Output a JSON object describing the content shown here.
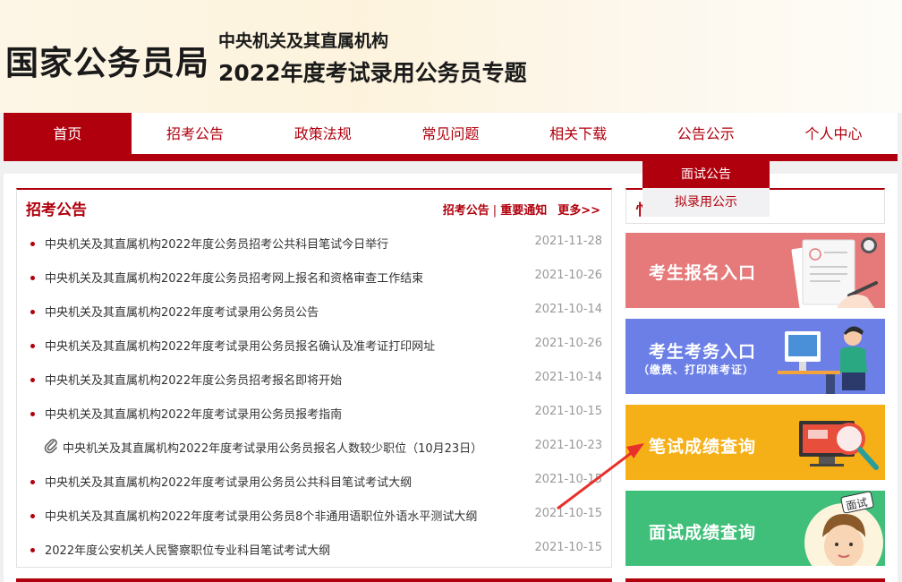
{
  "header": {
    "brand": "国家公务员局",
    "subtitle_line1": "中央机关及其直属机构",
    "subtitle_line2": "2022年度考试录用公务员专题"
  },
  "nav": {
    "items": [
      {
        "label": "首页",
        "active": true
      },
      {
        "label": "招考公告"
      },
      {
        "label": "政策法规"
      },
      {
        "label": "常见问题"
      },
      {
        "label": "相关下载"
      },
      {
        "label": "公告公示"
      },
      {
        "label": "个人中心"
      }
    ],
    "dropdown": [
      {
        "label": "面试公告",
        "active": true
      },
      {
        "label": "拟录用公示"
      }
    ]
  },
  "announcements": {
    "title": "招考公告",
    "link1": "招考公告",
    "sep": "|",
    "link2": "重要通知",
    "more": "更多>>",
    "items": [
      {
        "title": "中央机关及其直属机构2022年度公务员招考公共科目笔试今日举行",
        "date": "2021-11-28"
      },
      {
        "title": "中央机关及其直属机构2022年度公务员招考网上报名和资格审查工作结束",
        "date": "2021-10-26"
      },
      {
        "title": "中央机关及其直属机构2022年度考试录用公务员公告",
        "date": "2021-10-14"
      },
      {
        "title": "中央机关及其直属机构2022年度考试录用公务员报名确认及准考证打印网址",
        "date": "2021-10-26"
      },
      {
        "title": "中央机关及其直属机构2022年度公务员招考报名即将开始",
        "date": "2021-10-14"
      },
      {
        "title": "中央机关及其直属机构2022年度考试录用公务员报考指南",
        "date": "2021-10-15"
      },
      {
        "title": "中央机关及其直属机构2022年度考试录用公务员报名人数较少职位（10月23日）",
        "date": "2021-10-23",
        "attachment": true
      },
      {
        "title": "中央机关及其直属机构2022年度考试录用公务员公共科目笔试考试大纲",
        "date": "2021-10-15"
      },
      {
        "title": "中央机关及其直属机构2022年度考试录用公务员8个非通用语职位外语水平测试大纲",
        "date": "2021-10-15"
      },
      {
        "title": "2022年度公安机关人民警察职位专业科目笔试考试大纲",
        "date": "2021-10-15"
      }
    ]
  },
  "right_panel": {
    "title_fragment": "忄"
  },
  "cards": {
    "register": {
      "label": "考生报名入口",
      "color": "#e67a7a"
    },
    "exam_affairs": {
      "label": "考生考务入口",
      "sublabel": "（缴费、打印准考证）",
      "color": "#6b7fe6"
    },
    "written_score": {
      "label": "笔试成绩查询",
      "color": "#f6b017"
    },
    "interview_score": {
      "label": "面试成绩查询",
      "badge": "面试",
      "color": "#3fbf79"
    }
  },
  "annotation": {
    "arrow_color": "#e8302a"
  }
}
